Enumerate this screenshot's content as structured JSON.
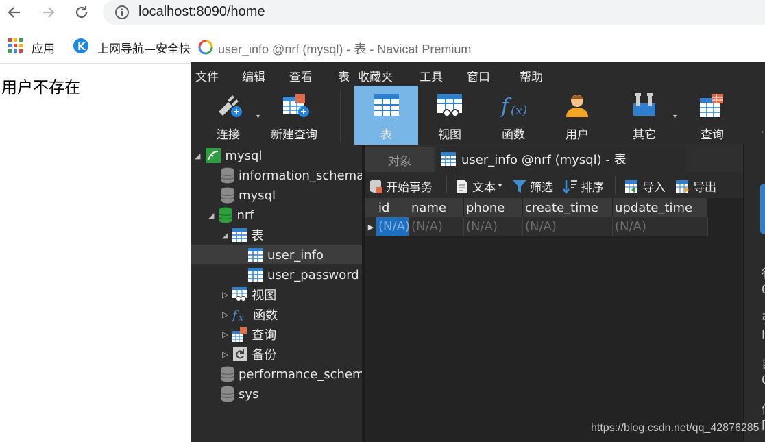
{
  "browser": {
    "url": "localhost:8090/home",
    "bookmarks": {
      "apps": "应用",
      "nav": "上网导航—安全快"
    }
  },
  "page": {
    "message": "用户不存在"
  },
  "navicat": {
    "title": "user_info @nrf (mysql) - 表 - Navicat Premium",
    "menu": [
      "文件",
      "编辑",
      "查看",
      "表",
      "收藏夹",
      "工具",
      "窗口",
      "帮助"
    ],
    "toolbar": {
      "connect": "连接",
      "new_query": "新建查询",
      "table": "表",
      "view": "视图",
      "function": "函数",
      "user": "用户",
      "other": "其它",
      "query": "查询"
    },
    "tree": {
      "mysql_conn": "mysql",
      "information_schema": "information_schema",
      "mysql_db": "mysql",
      "nrf": "nrf",
      "tables": "表",
      "user_info": "user_info",
      "user_password": "user_password",
      "views": "视图",
      "functions": "函数",
      "queries": "查询",
      "backup": "备份",
      "performance_schema": "performance_schema",
      "sys": "sys"
    },
    "tabs": {
      "objects": "对象",
      "active": "user_info @nrf (mysql) - 表"
    },
    "subtoolbar": {
      "begin_tx": "开始事务",
      "text": "文本",
      "filter": "筛选",
      "sort": "排序",
      "import": "导入",
      "export": "导出"
    },
    "grid": {
      "columns": [
        "id",
        "name",
        "phone",
        "create_time",
        "update_time"
      ],
      "rows": [
        [
          "(N/A)",
          "(N/A)",
          "(N/A)",
          "(N/A)",
          "(N/A)"
        ]
      ]
    },
    "right_panel": [
      "行",
      "0",
      "引",
      "I",
      "自",
      "0",
      "修",
      "["
    ]
  },
  "watermark": "https://blog.csdn.net/qq_42876285",
  "colors": {
    "selected_tool": "#79b6e8",
    "selected_cell": "#1f6fc1",
    "db_green": "#2e9e3e"
  }
}
